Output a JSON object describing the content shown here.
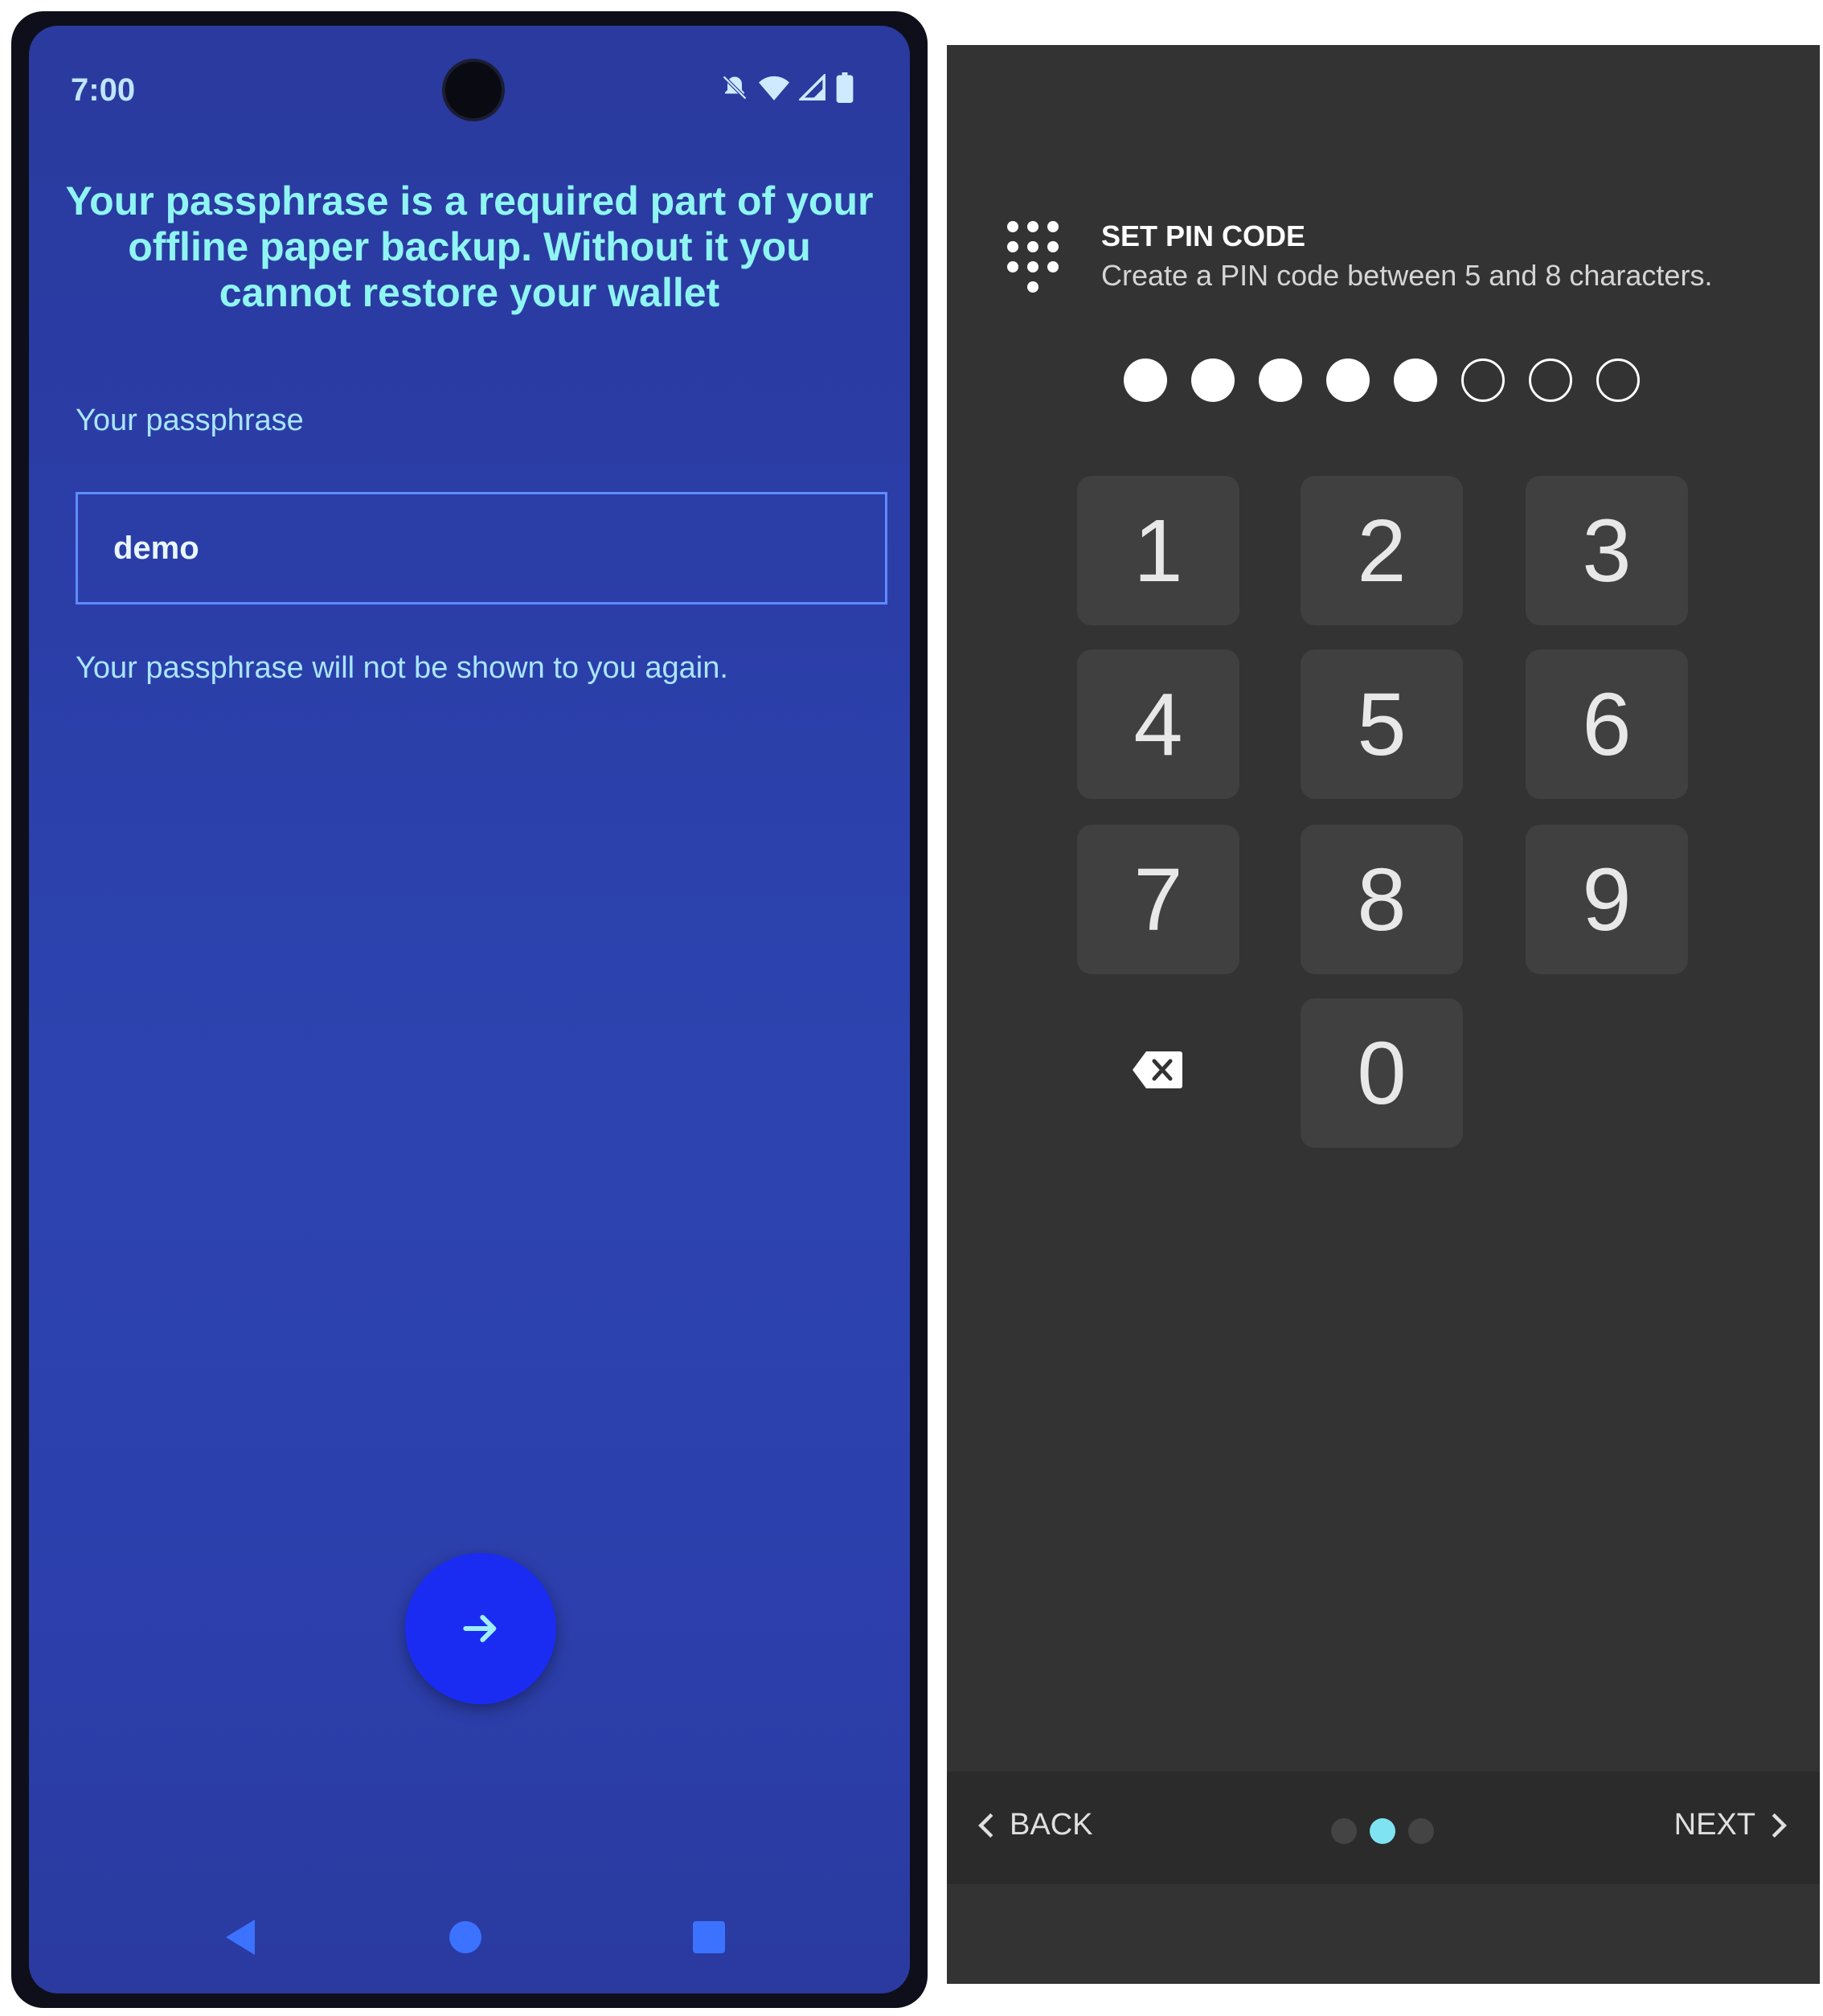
{
  "phone": {
    "status": {
      "time": "7:00",
      "icons": [
        "silent-icon",
        "wifi-icon",
        "signal-icon",
        "battery-icon"
      ]
    },
    "headline": "Your passphrase is a required part of your offline paper backup. Without it you cannot restore your wallet",
    "passphrase_label": "Your passphrase",
    "passphrase_value": "demo",
    "note": "Your passphrase will not be shown to you again.",
    "next_button_icon": "arrow-right-icon",
    "colors": {
      "accent_text": "#8ff5f2",
      "fab": "#1a2cf2",
      "field_border": "#5f8cff"
    }
  },
  "pin": {
    "title": "SET PIN CODE",
    "subtitle": "Create a PIN code between 5 and 8 characters.",
    "entered": 5,
    "max_length": 8,
    "keys": [
      "1",
      "2",
      "3",
      "4",
      "5",
      "6",
      "7",
      "8",
      "9",
      "0"
    ],
    "backspace_icon": "backspace-icon",
    "back_label": "BACK",
    "next_label": "NEXT",
    "pager_total": 3,
    "pager_active": 2,
    "colors": {
      "background": "#333333",
      "key": "#404040",
      "pager_active": "#7fe3f2"
    }
  }
}
